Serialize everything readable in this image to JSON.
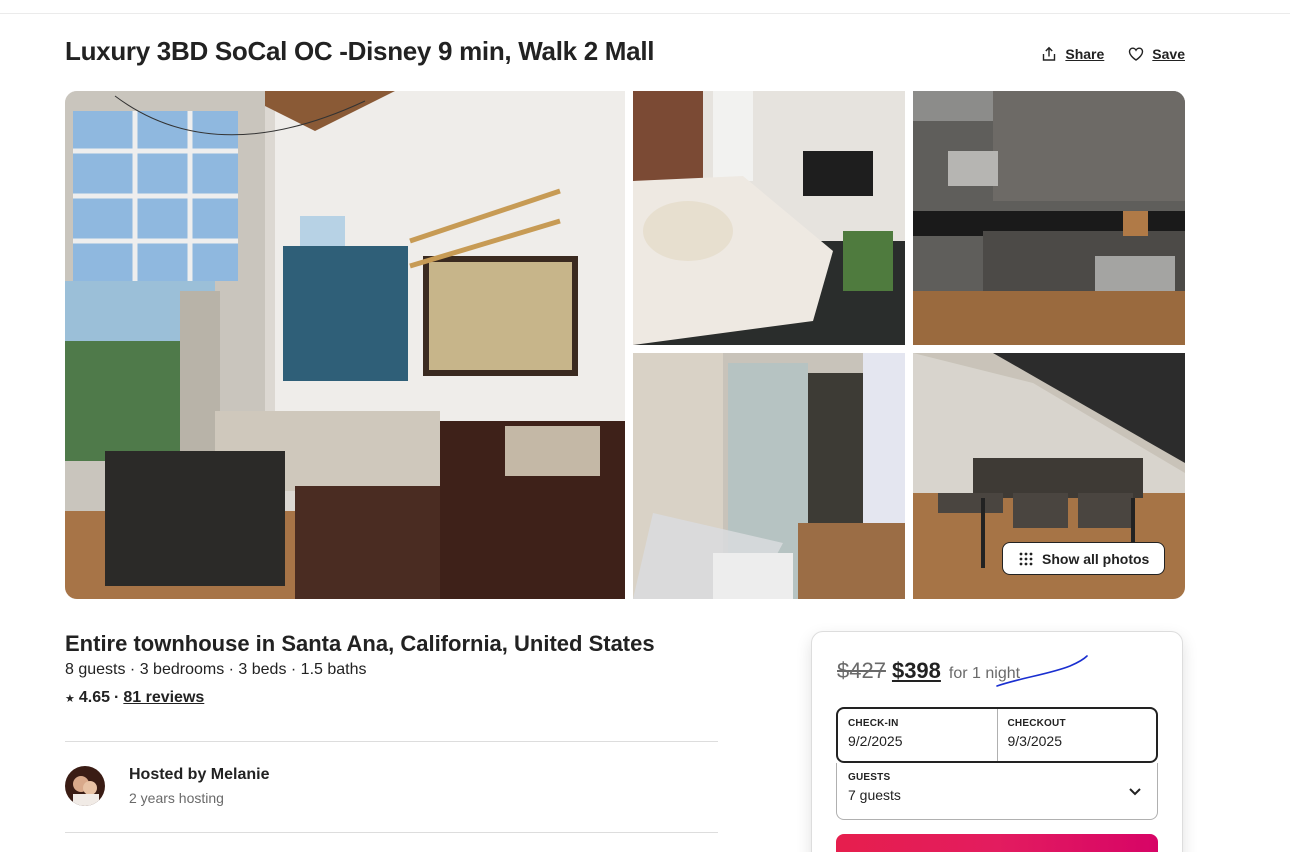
{
  "listing": {
    "title": "Luxury 3BD SoCal OC -Disney 9 min, Walk 2 Mall",
    "share_label": "Share",
    "save_label": "Save",
    "show_all_photos_label": "Show all photos",
    "subtitle": "Entire townhouse in Santa Ana, California, United States",
    "facts": "8 guests · 3 bedrooms · 3 beds · 1.5 baths",
    "rating_star": "★",
    "rating_value": "4.65",
    "rating_separator": "·",
    "reviews_label": "81 reviews"
  },
  "host": {
    "name_line": "Hosted by Melanie",
    "years_line": "2 years hosting"
  },
  "booking": {
    "old_price": "$427",
    "new_price": "$398",
    "per_label": "for 1 night",
    "checkin_label": "CHECK-IN",
    "checkin_value": "9/2/2025",
    "checkout_label": "CHECKOUT",
    "checkout_value": "9/3/2025",
    "guests_label": "GUESTS",
    "guests_value": "7 guests"
  },
  "photos": {
    "main": "living-room-photo",
    "bedroom": "bedroom-photo",
    "kitchen": "kitchen-photo",
    "patio": "patio-photo",
    "dining": "dining-photo"
  },
  "colors": {
    "brand_pink": "#e31c5f",
    "text": "#222222",
    "muted": "#6a6a6a",
    "annotation_blue": "#1a2fd0"
  },
  "icons": [
    "share-icon",
    "heart-icon",
    "grid-dots-icon",
    "star-icon",
    "chevron-down-icon"
  ]
}
